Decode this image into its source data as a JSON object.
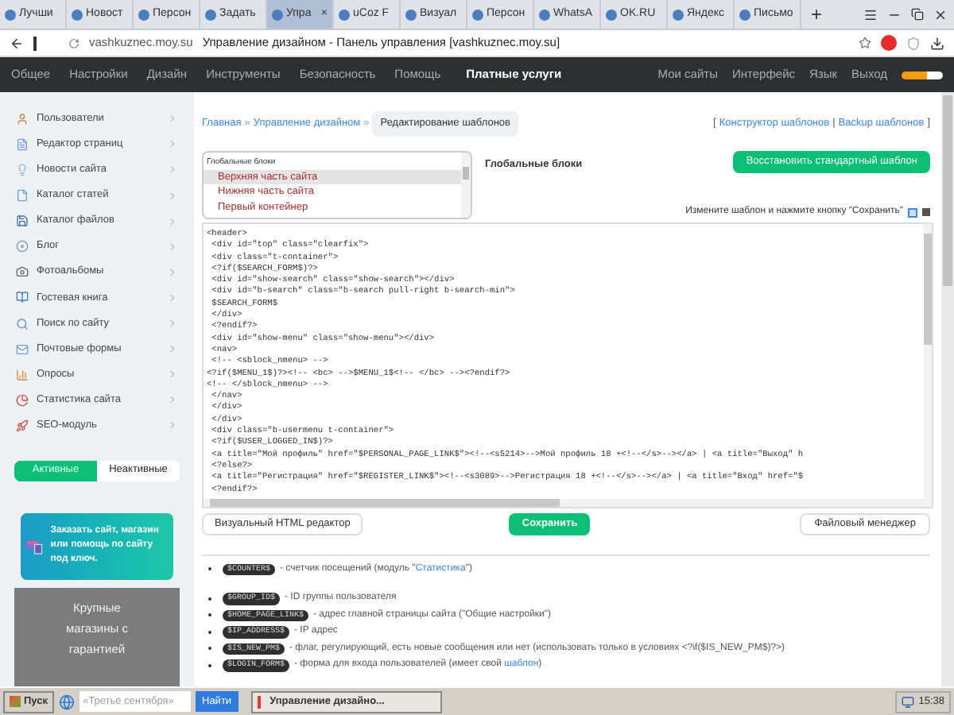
{
  "browser": {
    "tabs": [
      {
        "label": "Лучши",
        "selected": false
      },
      {
        "label": "Новост",
        "selected": false
      },
      {
        "label": "Персон",
        "selected": false
      },
      {
        "label": "Задать",
        "selected": false
      },
      {
        "label": "Упра",
        "selected": true,
        "close": "×"
      },
      {
        "label": "uCoz F",
        "selected": false
      },
      {
        "label": "Визуал",
        "selected": false
      },
      {
        "label": "Персон",
        "selected": false
      },
      {
        "label": "WhatsA",
        "selected": false
      },
      {
        "label": "OK.RU",
        "selected": false
      },
      {
        "label": "Яндекс",
        "selected": false
      },
      {
        "label": "Письмо",
        "selected": false
      }
    ],
    "new_tab": "+",
    "address": {
      "domain": "vashkuznec.moy.su",
      "title": "Управление дизайном - Панель управления [vashkuznec.moy.su]"
    }
  },
  "nav": {
    "items": [
      {
        "label": "Общее",
        "selected": false
      },
      {
        "label": "Настройки",
        "selected": false
      },
      {
        "label": "Дизайн",
        "selected": false
      },
      {
        "label": "Инструменты",
        "selected": false
      },
      {
        "label": "Безопасность",
        "selected": false
      },
      {
        "label": "Помощь",
        "selected": false
      },
      {
        "label": "Платные услуги",
        "selected": true
      }
    ],
    "right": [
      "Мои сайты",
      "Интерфейс",
      "Язык",
      "Выход"
    ]
  },
  "sidebar": {
    "items": [
      "Пользователи",
      "Редактор страниц",
      "Новости сайта",
      "Каталог статей",
      "Каталог файлов",
      "Блог",
      "Фотоальбомы",
      "Гостевая книга",
      "Поиск по сайту",
      "Почтовые формы",
      "Опросы",
      "Статистика сайта",
      "SEO-модуль"
    ],
    "toggle": [
      {
        "label": "Активные",
        "selected": true
      },
      {
        "label": "Неактивные",
        "selected": false
      }
    ],
    "promo": "Заказать сайт, магазин или помощь по сайту под ключ.",
    "banner": "Крупные магазины с гарантией"
  },
  "breadcrumb": {
    "links": [
      "Главная",
      "Управление дизайном"
    ],
    "separator": "»",
    "current": "Редактирование шаблонов"
  },
  "top_links": [
    "Конструктор шаблонов",
    "Backup шаблонов"
  ],
  "top_links_marks": {
    "open": "[",
    "separator": "|",
    "close": "]"
  },
  "blocks": {
    "group": "Глобальные блоки",
    "items": [
      {
        "label": "Верхняя часть сайта",
        "selected": true
      },
      {
        "label": "Нижняя часть сайта",
        "selected": false
      },
      {
        "label": "Первый контейнер",
        "selected": false
      }
    ]
  },
  "blocks_label": "Глобальные блоки",
  "restore_button": "Восстановить стандартный шаблон",
  "hint": "Измените шаблон и нажмите кнопку \"Сохранить\"",
  "code": [
    "<header>",
    " <div id=\"top\" class=\"clearfix\">",
    " <div class=\"t-container\">",
    " <?if($SEARCH_FORM$)?>",
    " <div id=\"show-search\" class=\"show-search\"></div>",
    " <div id=\"b-search\" class=\"b-search pull-right b-search-min\">",
    " $SEARCH_FORM$",
    " </div>",
    " <?endif?>",
    " <div id=\"show-menu\" class=\"show-menu\"></div>",
    " <nav>",
    " <!-- <sblock_nmenu> -->",
    "<?if($MENU_1$)?><!-- <bc> -->$MENU_1$<!-- </bc> --><?endif?>",
    "<!-- </sblock_nmenu> -->",
    " </nav>",
    " </div>",
    " </div>",
    " <div class=\"b-usermenu t-container\">",
    " <?if($USER_LOGGED_IN$)?>",
    " <a title=\"Мой профиль\" href=\"$PERSONAL_PAGE_LINK$\"><!--<s5214>-->Мой профиль 18 +<!--</s>--></a> | <a title=\"Выход\" h",
    " <?else?>",
    " <a title=\"Регистрация\" href=\"$REGISTER_LINK$\"><!--<s3089>-->Регистрация 18 +<!--</s>--></a> | <a title=\"Вход\" href=\"$",
    " <?endif?>"
  ],
  "buttons": {
    "visual": "Визуальный HTML редактор",
    "save": "Сохранить",
    "files": "Файловый менеджер"
  },
  "variable_groups": [
    [
      {
        "tag": "$COUNTER$",
        "text": " - счетчик посещений (модуль \"",
        "link": "Статистика",
        "after": "\")"
      }
    ],
    [
      {
        "tag": "$GROUP_ID$",
        "text": " - ID группы пользователя"
      },
      {
        "tag": "$HOME_PAGE_LINK$",
        "text": " - адрес главной страницы сайта (\"Общие настройки\")"
      },
      {
        "tag": "$IP_ADDRESS$",
        "text": " - IP адрес"
      },
      {
        "tag": "$IS_NEW_PM$",
        "text": " - флаг, регулирующий, есть новые сообщения или нет (использовать только в условиях <?if($IS_NEW_PM$)?>)"
      },
      {
        "tag": "$LOGIN_FORM$",
        "text": " - форма для входа пользователей (имеет свой ",
        "link": "шаблон",
        "after": ")"
      }
    ]
  ],
  "taskbar": {
    "start": "Пуск",
    "search_placeholder": "«Третье сентября»",
    "search_button": "Найти",
    "task": "Управление дизайно...",
    "clock": "15:38"
  }
}
